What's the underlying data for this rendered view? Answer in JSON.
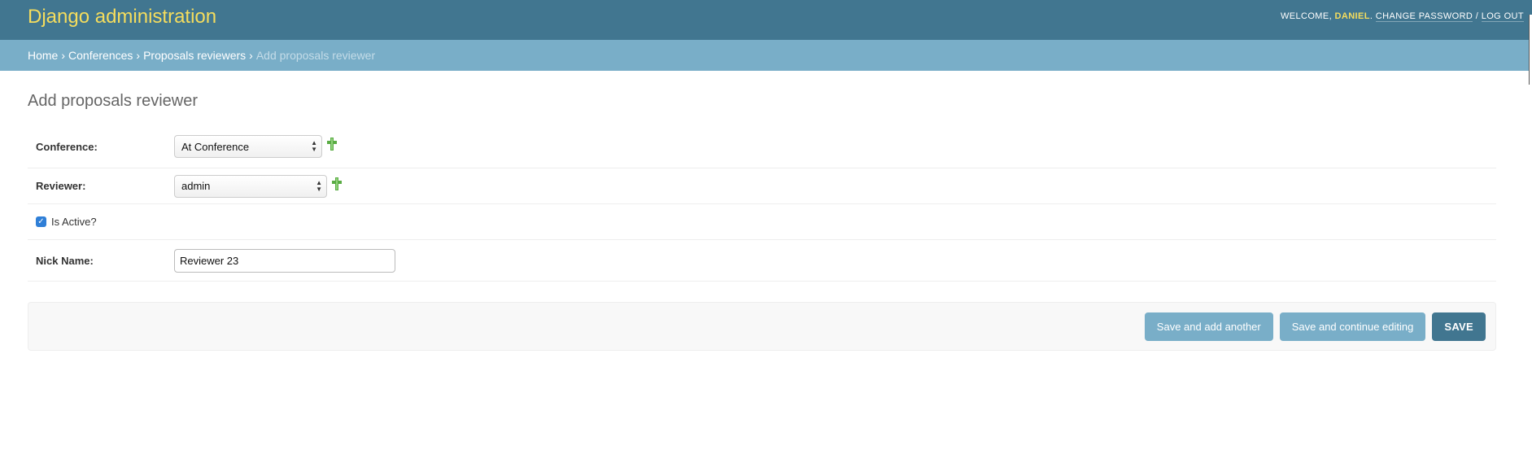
{
  "header": {
    "branding": "Django administration",
    "welcome": "WELCOME,",
    "username": "DANIEL",
    "change_password": "CHANGE PASSWORD",
    "separator": "/",
    "logout": "LOG OUT"
  },
  "breadcrumbs": {
    "home": "Home",
    "conferences": "Conferences",
    "proposals_reviewers": "Proposals reviewers",
    "current": "Add proposals reviewer",
    "sep": "›"
  },
  "page": {
    "title": "Add proposals reviewer"
  },
  "form": {
    "conference": {
      "label": "Conference:",
      "value": "At Conference"
    },
    "reviewer": {
      "label": "Reviewer:",
      "value": "admin"
    },
    "is_active": {
      "label": "Is Active?",
      "checked": true
    },
    "nick_name": {
      "label": "Nick Name:",
      "value": "Reviewer 23"
    }
  },
  "actions": {
    "save_add_another": "Save and add another",
    "save_continue": "Save and continue editing",
    "save": "SAVE"
  },
  "colors": {
    "header_bg": "#417690",
    "breadcrumb_bg": "#79aec8",
    "branding": "#f5dd5d",
    "add_icon": "#5aac44"
  },
  "icons": {
    "add": "plus-icon",
    "checkbox": "checkmark-icon",
    "select": "updown-arrows-icon"
  }
}
